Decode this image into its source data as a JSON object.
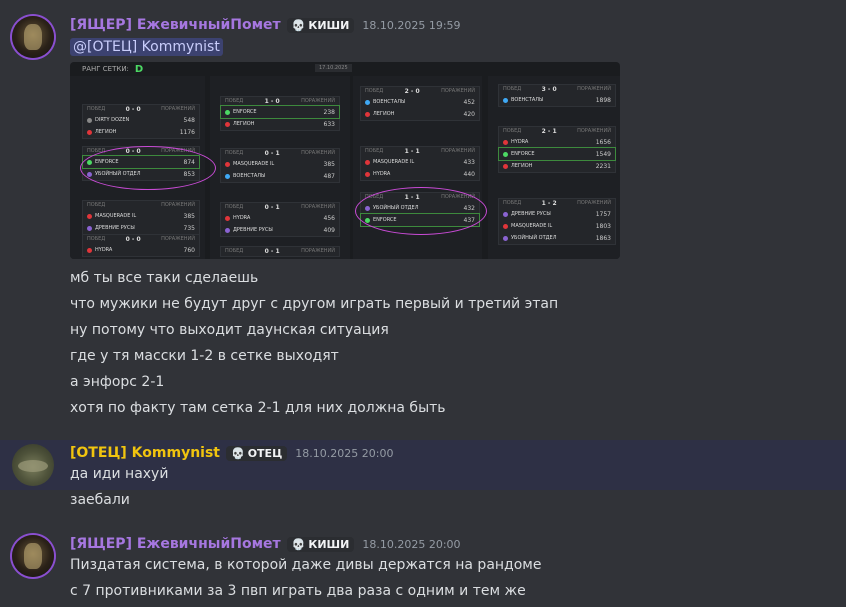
{
  "messages": [
    {
      "author": "[ЯЩЕР] ЕжевичныйПомет",
      "role_tag": "КИШИ",
      "timestamp": "18.10.2025 19:59",
      "mention": "@[ОТЕЦ] Kommynist",
      "lines": [
        "мб ты все таки сделаешь",
        "что мужики не будут друг с другом играть первый и третий этап",
        "ну потому что выходит даунская ситуация",
        "где у тя масски 1-2 в сетке выходят",
        "а энфорс 2-1",
        "хотя по факту там сетка 2-1 для них должна быть"
      ]
    },
    {
      "author": "[ОТЕЦ] Kommynist",
      "role_tag": "ОТЕЦ",
      "timestamp": "18.10.2025 20:00",
      "lines": [
        "да иди нахуй",
        "заебали"
      ]
    },
    {
      "author": "[ЯЩЕР] ЕжевичныйПомет",
      "role_tag": "КИШИ",
      "timestamp": "18.10.2025 20:00",
      "lines": [
        "Пиздатая система, в которой даже дивы держатся на рандоме",
        "с 7 противниками за 3 пвп играть два раза с одним и тем же"
      ]
    }
  ],
  "bracket": {
    "rank_label": "РАНГ СЕТКИ:",
    "rank_value": "D",
    "date": "17.10.2025",
    "head_wins": "ПОБЕД",
    "head_losses": "ПОРАЖЕНИЙ",
    "col1": [
      {
        "score": "0 - 0",
        "teams": [
          [
            "DIRTY DOZEN",
            "548",
            "gray"
          ],
          [
            "ЛЕГИОН",
            "1176",
            "red"
          ]
        ]
      },
      {
        "score": "0 - 0",
        "teams": [
          [
            "ENFORCE",
            "874",
            "green"
          ],
          [
            "УБОЙНЫЙ ОТДЕЛ",
            "853",
            "purple"
          ]
        ]
      },
      {
        "score": "",
        "teams": [
          [
            "MASQUERADE IL",
            "385",
            "red"
          ],
          [
            "ДРЕВНИЕ РУСЫ",
            "735",
            "purple"
          ]
        ]
      },
      {
        "score": "0 - 0",
        "teams": [
          [
            "HYDRA",
            "760",
            "red"
          ]
        ]
      }
    ],
    "col2": [
      {
        "score": "1 - 0",
        "teams": [
          [
            "ENFORCE",
            "238",
            "green"
          ],
          [
            "ЛЕГИОН",
            "633",
            "red"
          ]
        ]
      },
      {
        "score": "0 - 1",
        "teams": [
          [
            "MASQUERADE IL",
            "385",
            "red"
          ],
          [
            "ВОЕНСТАЛЫ",
            "487",
            "blue"
          ]
        ]
      },
      {
        "score": "0 - 1",
        "teams": [
          [
            "HYDRA",
            "456",
            "red"
          ],
          [
            "ДРЕВНИЕ РУСЫ",
            "409",
            "purple"
          ]
        ]
      },
      {
        "score": "0 - 1",
        "teams": []
      }
    ],
    "col3": [
      {
        "score": "2 - 0",
        "teams": [
          [
            "ВОЕНСТАЛЫ",
            "452",
            "blue"
          ],
          [
            "ЛЕГИОН",
            "420",
            "red"
          ]
        ]
      },
      {
        "score": "1 - 1",
        "teams": [
          [
            "MASQUERADE IL",
            "433",
            "red"
          ],
          [
            "HYDRA",
            "440",
            "red"
          ]
        ]
      },
      {
        "score": "1 - 1",
        "teams": [
          [
            "УБОЙНЫЙ ОТДЕЛ",
            "432",
            "purple"
          ],
          [
            "ENFORCE",
            "437",
            "green"
          ]
        ]
      }
    ],
    "col4": [
      {
        "score": "3 - 0",
        "teams": [
          [
            "ВОЕНСТАЛЫ",
            "1898",
            "blue"
          ]
        ]
      },
      {
        "score": "2 - 1",
        "teams": [
          [
            "HYDRA",
            "1656",
            "red"
          ],
          [
            "ENFORCE",
            "1549",
            "green"
          ],
          [
            "ЛЕГИОН",
            "2231",
            "red"
          ]
        ]
      },
      {
        "score": "1 - 2",
        "teams": [
          [
            "ДРЕВНИЕ РУСЫ",
            "1757",
            "purple"
          ],
          [
            "MASQUERADE IL",
            "1803",
            "red"
          ],
          [
            "УБОЙНЫЙ ОТДЕЛ",
            "1863",
            "purple"
          ]
        ]
      }
    ]
  }
}
